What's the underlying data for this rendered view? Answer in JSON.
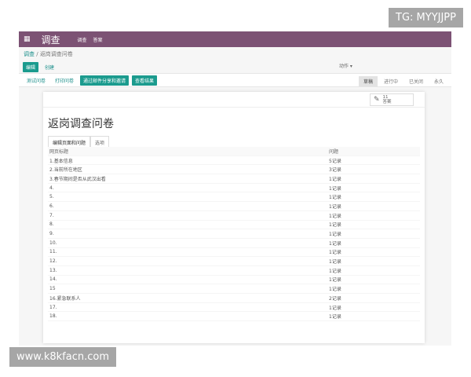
{
  "watermarks": {
    "top": "TG: MYYJJPP",
    "bottom": "www.k8kfacn.com"
  },
  "appbar": {
    "brand": "调查",
    "menu": [
      "调查",
      "答案"
    ]
  },
  "breadcrumb": {
    "parent": "调查",
    "current": "返岗调查问卷"
  },
  "buttons": {
    "edit": "编辑",
    "create": "创建",
    "actions": "动作 ▾"
  },
  "control": [
    "测试问卷",
    "打印问卷",
    "通过邮件分享和邀请",
    "查看结果"
  ],
  "status": [
    "草稿",
    "进行中",
    "已关闭",
    "永久"
  ],
  "stat": {
    "count": "11",
    "label": "答案"
  },
  "form": {
    "title": "返岗调查问卷",
    "tabs": [
      "编辑页面和问题",
      "选项"
    ]
  },
  "table": {
    "headers": [
      "网页标题",
      "问题"
    ],
    "rows": [
      [
        "1.基本信息",
        "5记录"
      ],
      [
        "2.当前所在地区",
        "3记录"
      ],
      [
        "3.春节期间是否从武汉出看",
        "1记录"
      ],
      [
        "4.",
        "1记录"
      ],
      [
        "5.",
        "1记录"
      ],
      [
        "6.",
        "1记录"
      ],
      [
        "7.",
        "1记录"
      ],
      [
        "8.",
        "1记录"
      ],
      [
        "9.",
        "1记录"
      ],
      [
        "10.",
        "1记录"
      ],
      [
        "11.",
        "1记录"
      ],
      [
        "12.",
        "1记录"
      ],
      [
        "13.",
        "1记录"
      ],
      [
        "14.",
        "1记录"
      ],
      [
        "15",
        "1记录"
      ],
      [
        "16.紧急联系人",
        "2记录"
      ],
      [
        "17.",
        "1记录"
      ],
      [
        "18.",
        "1记录"
      ]
    ]
  }
}
